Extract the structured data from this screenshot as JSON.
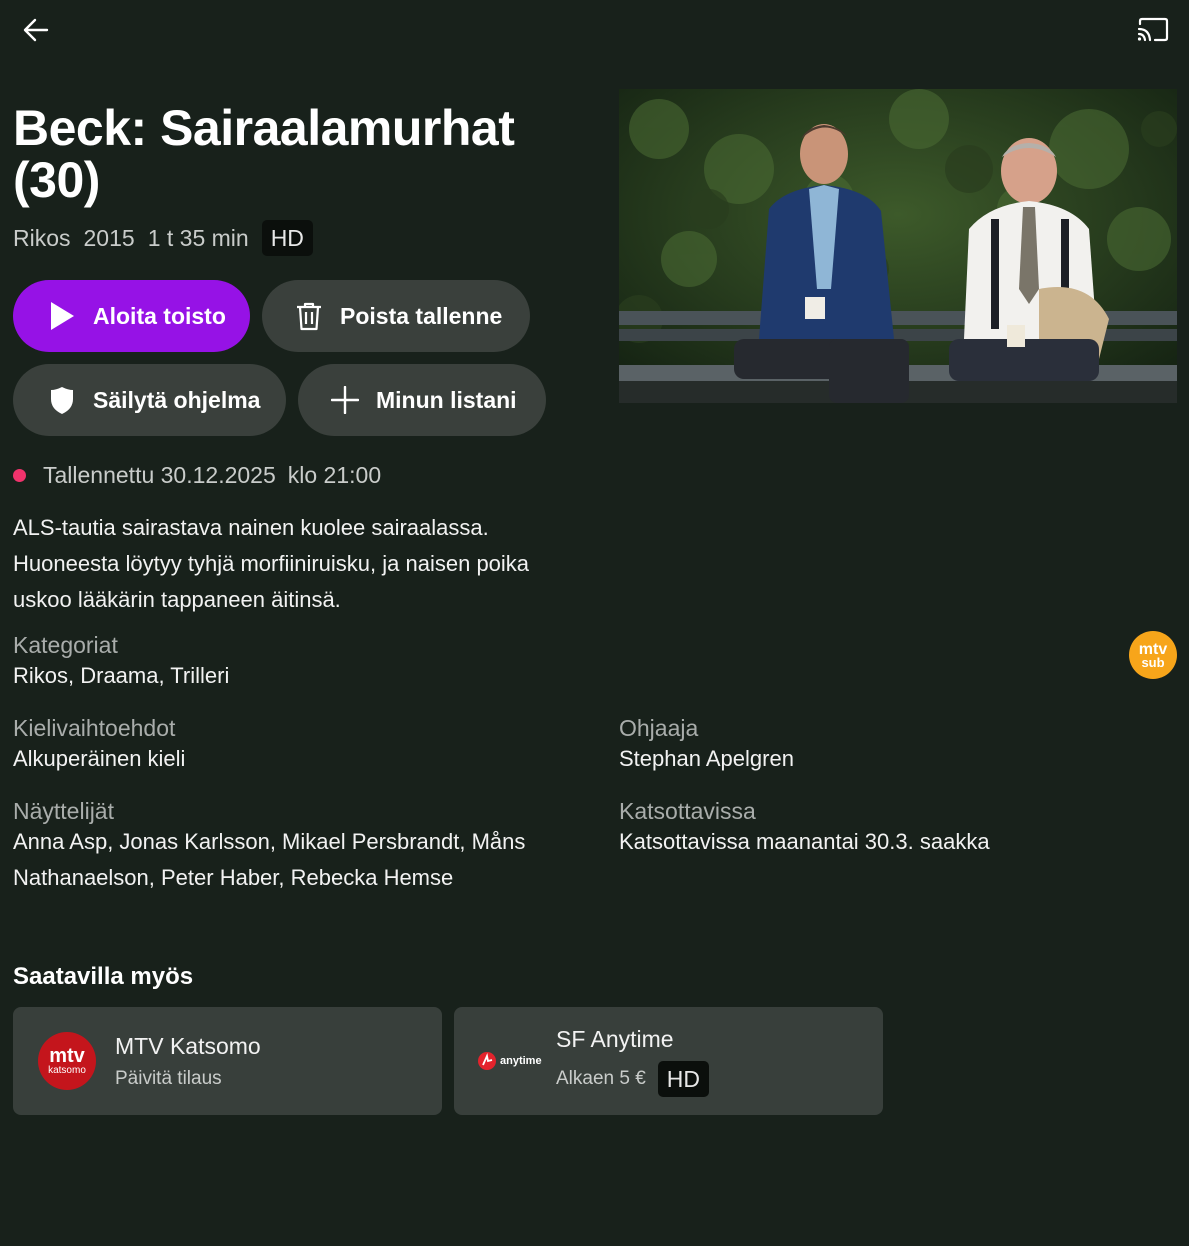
{
  "header": {
    "back_icon": "arrow-left-icon",
    "cast_icon": "cast-icon"
  },
  "program": {
    "title": "Beck: Sairaalamurhat (30)",
    "genre": "Rikos",
    "year": "2015",
    "duration": "1 t 35 min",
    "quality": "HD"
  },
  "actions": {
    "play_label": "Aloita toisto",
    "delete_label": "Poista tallenne",
    "keep_label": "Säilytä ohjelma",
    "mylist_label": "Minun listani"
  },
  "recording": {
    "label": "Tallennettu 30.12.2025",
    "time": "klo 21:00",
    "dot_color": "#f0336c"
  },
  "description": "ALS-tautia sairastava nainen kuolee sairaalassa. Huoneesta löytyy tyhjä morfiiniruisku, ja naisen poika uskoo lääkärin tappaneen äitinsä.",
  "details": {
    "categories_label": "Kategoriat",
    "categories_value": "Rikos, Draama, Trilleri",
    "languages_label": "Kielivaihtoehdot",
    "languages_value": "Alkuperäinen kieli",
    "director_label": "Ohjaaja",
    "director_value": "Stephan Apelgren",
    "actors_label": "Näyttelijät",
    "actors_value": "Anna Asp, Jonas Karlsson, Mikael Persbrandt, Måns Nathanaelson, Peter Haber, Rebecka Hemse",
    "available_label": "Katsottavissa",
    "available_value": "Katsottavissa maanantai 30.3. saakka"
  },
  "channel": {
    "logo_top": "mtv",
    "logo_bottom": "sub",
    "color": "#f7a51a"
  },
  "also_available": {
    "title": "Saatavilla myös",
    "providers": [
      {
        "name": "MTV Katsomo",
        "sub": "Päivitä tilaus",
        "logo_top": "mtv",
        "logo_bottom": "katsomo"
      },
      {
        "name": "SF Anytime",
        "sub": "Alkaen 5 €",
        "badge": "HD",
        "logo_text": "anytime"
      }
    ]
  },
  "colors": {
    "background": "#18211b",
    "accent": "#9612e6",
    "button": "#3a403c",
    "card": "#383f3b"
  }
}
